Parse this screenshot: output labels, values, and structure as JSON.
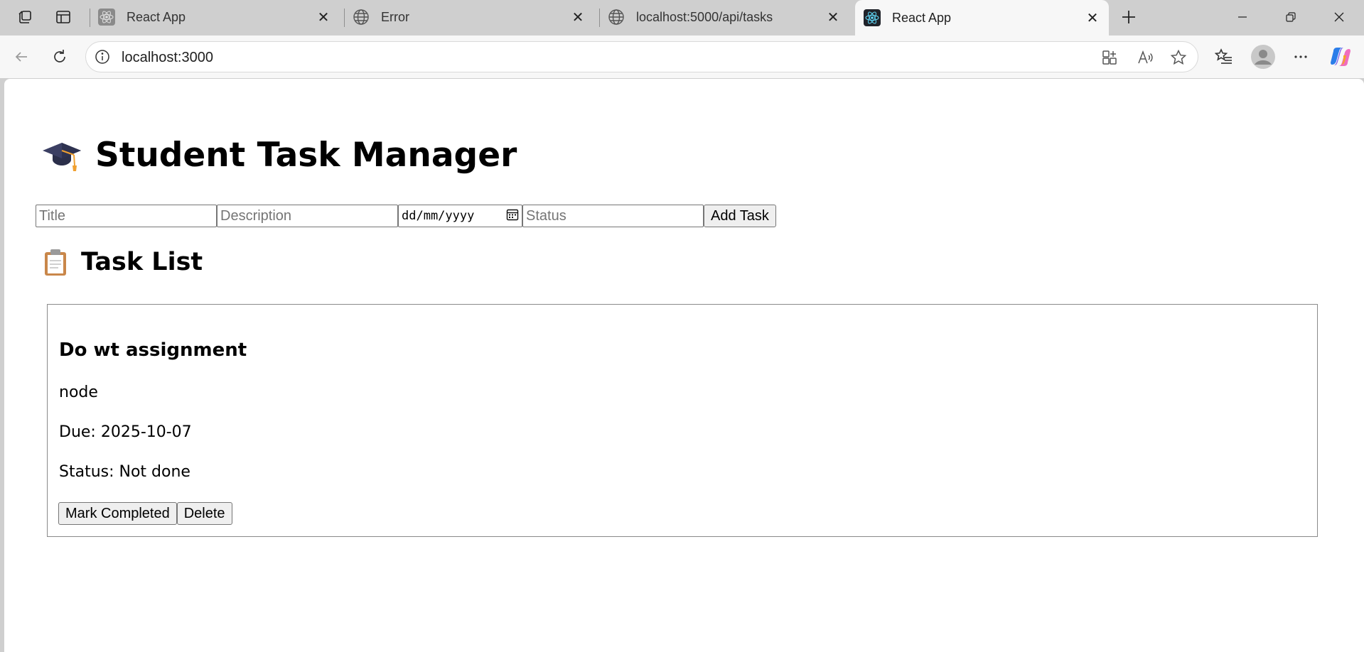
{
  "browser": {
    "tabs": [
      {
        "title": "React App",
        "icon": "react-icon",
        "active": false
      },
      {
        "title": "Error",
        "icon": "globe-icon",
        "active": false
      },
      {
        "title": "localhost:5000/api/tasks",
        "icon": "globe-icon",
        "active": false
      },
      {
        "title": "React App",
        "icon": "react-icon",
        "active": true
      }
    ],
    "address_url": "localhost:3000"
  },
  "page": {
    "title": "Student Task Manager",
    "form": {
      "title_placeholder": "Title",
      "description_placeholder": "Description",
      "date_placeholder": "dd/mm/yyyy",
      "status_placeholder": "Status",
      "add_label": "Add Task"
    },
    "list_title": "Task List",
    "tasks": [
      {
        "title": "Do wt assignment",
        "description": "node",
        "due": "Due: 2025-10-07",
        "status": "Status: Not done",
        "complete_label": "Mark Completed",
        "delete_label": "Delete"
      }
    ]
  },
  "colors": {
    "tabstrip_bg": "#cfcfcf",
    "toolbar_bg": "#f7f7f7",
    "react_logo": "#61dafb",
    "button_bg": "#efefef"
  }
}
